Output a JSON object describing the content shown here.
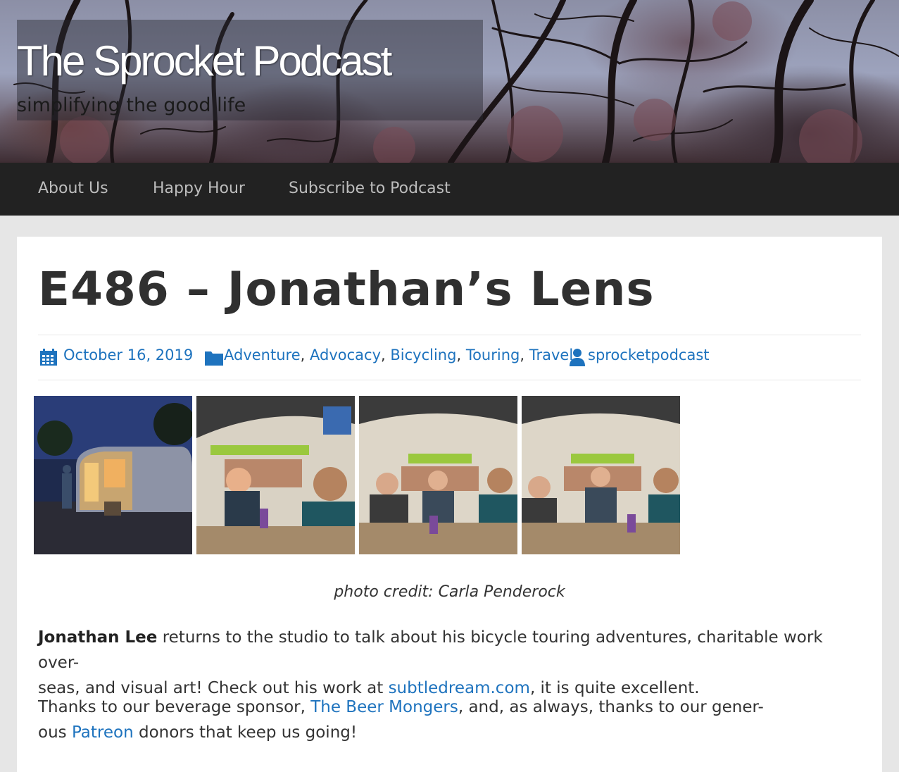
{
  "site": {
    "title": "The Sprocket Podcast",
    "tagline": "simplifying the good life"
  },
  "nav": {
    "items": [
      "About Us",
      "Happy Hour",
      "Subscribe to Podcast"
    ]
  },
  "post": {
    "title": "E486 – Jonathan’s Lens",
    "date": "October 16, 2019",
    "categories": [
      "Adventure",
      "Advocacy",
      "Bicycling",
      "Touring",
      "Travel"
    ],
    "category_separator": ",",
    "author": "sprocketpodcast",
    "photos": [
      {
        "alt": "airstream-night-photo"
      },
      {
        "alt": "studio-photo-1"
      },
      {
        "alt": "studio-photo-2"
      },
      {
        "alt": "studio-photo-3"
      }
    ],
    "photo_credit": "photo credit: Carla Penderock",
    "para1": {
      "bold": "Jonathan Lee",
      "text1": " returns to the studio to talk about his bicycle touring adventures, charitable work over-",
      "text2": "seas, and visual art!  Check out his work at ",
      "link": "subtledream.com",
      "text3": ", it is quite excellent."
    },
    "para2": {
      "text1": "Thanks to our beverage sponsor, ",
      "link1": "The Beer Mongers",
      "text2": ", and, as always, thanks to our gener-",
      "text3": "ous ",
      "link2": "Patreon",
      "text4": " donors that keep us going!"
    }
  },
  "colors": {
    "link": "#1e73be",
    "nav_bg": "#222222",
    "page_bg": "#e6e6e6"
  }
}
